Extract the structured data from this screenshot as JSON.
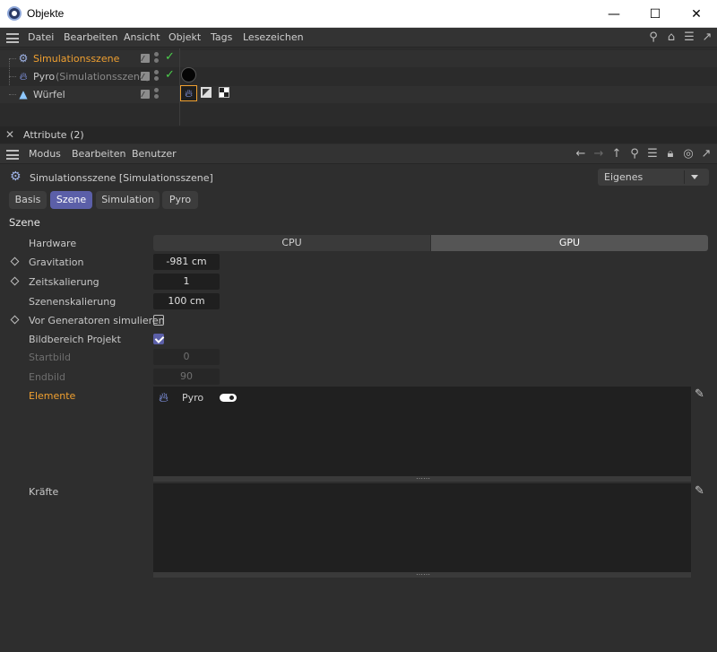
{
  "window": {
    "title": "Objekte",
    "min_glyph": "—",
    "max_glyph": "☐",
    "close_glyph": "✕"
  },
  "object_menu": {
    "items": [
      "Datei",
      "Bearbeiten",
      "Ansicht",
      "Objekt",
      "Tags",
      "Lesezeichen"
    ],
    "tool_icons": [
      "search-icon",
      "home-icon",
      "filter-icon",
      "new-window-icon"
    ]
  },
  "objects": [
    {
      "name": "Simulationsszene",
      "suffix": "",
      "icon": "gear-icon",
      "selected": true,
      "enabled": true
    },
    {
      "name": "Pyro",
      "suffix": "(Simulationsszene)",
      "icon": "flame-icon",
      "selected": false,
      "enabled": true
    },
    {
      "name": "Würfel",
      "suffix": "",
      "icon": "cube-icon",
      "selected": false,
      "enabled": false
    }
  ],
  "attributes": {
    "panel_title": "Attribute (2)",
    "menu": [
      "Modus",
      "Bearbeiten",
      "Benutzer"
    ],
    "tool_icons": [
      "arrow-left-icon",
      "arrow-right-icon",
      "arrow-up-icon",
      "search-icon",
      "filter-icon",
      "lock-icon",
      "target-icon",
      "new-window-icon"
    ],
    "object_label": "Simulationsszene [Simulationsszene]",
    "mode_dropdown": "Eigenes",
    "tabs": [
      {
        "label": "Basis",
        "active": false
      },
      {
        "label": "Szene",
        "active": true
      },
      {
        "label": "Simulation",
        "active": false
      },
      {
        "label": "Pyro",
        "active": false
      }
    ],
    "section_title": "Szene",
    "hardware": {
      "label": "Hardware",
      "options": [
        "CPU",
        "GPU"
      ],
      "selected": "GPU"
    },
    "gravitation": {
      "label": "Gravitation",
      "value": "-981 cm"
    },
    "zeitskalierung": {
      "label": "Zeitskalierung",
      "value": "1"
    },
    "szenenskalierung": {
      "label": "Szenenskalierung",
      "value": "100 cm"
    },
    "vor_generatoren": {
      "label": "Vor Generatoren simulieren",
      "checked": false
    },
    "bildbereich": {
      "label": "Bildbereich Projekt",
      "checked": true
    },
    "startbild": {
      "label": "Startbild",
      "value": "0"
    },
    "endbild": {
      "label": "Endbild",
      "value": "90"
    },
    "elemente": {
      "label": "Elemente",
      "items": [
        {
          "name": "Pyro",
          "enabled": true
        }
      ]
    },
    "kraefte": {
      "label": "Kräfte",
      "items": []
    }
  },
  "colors": {
    "accent": "#5b5fa8",
    "selected_text": "#f0a030",
    "check_green": "#4ccd4c"
  }
}
